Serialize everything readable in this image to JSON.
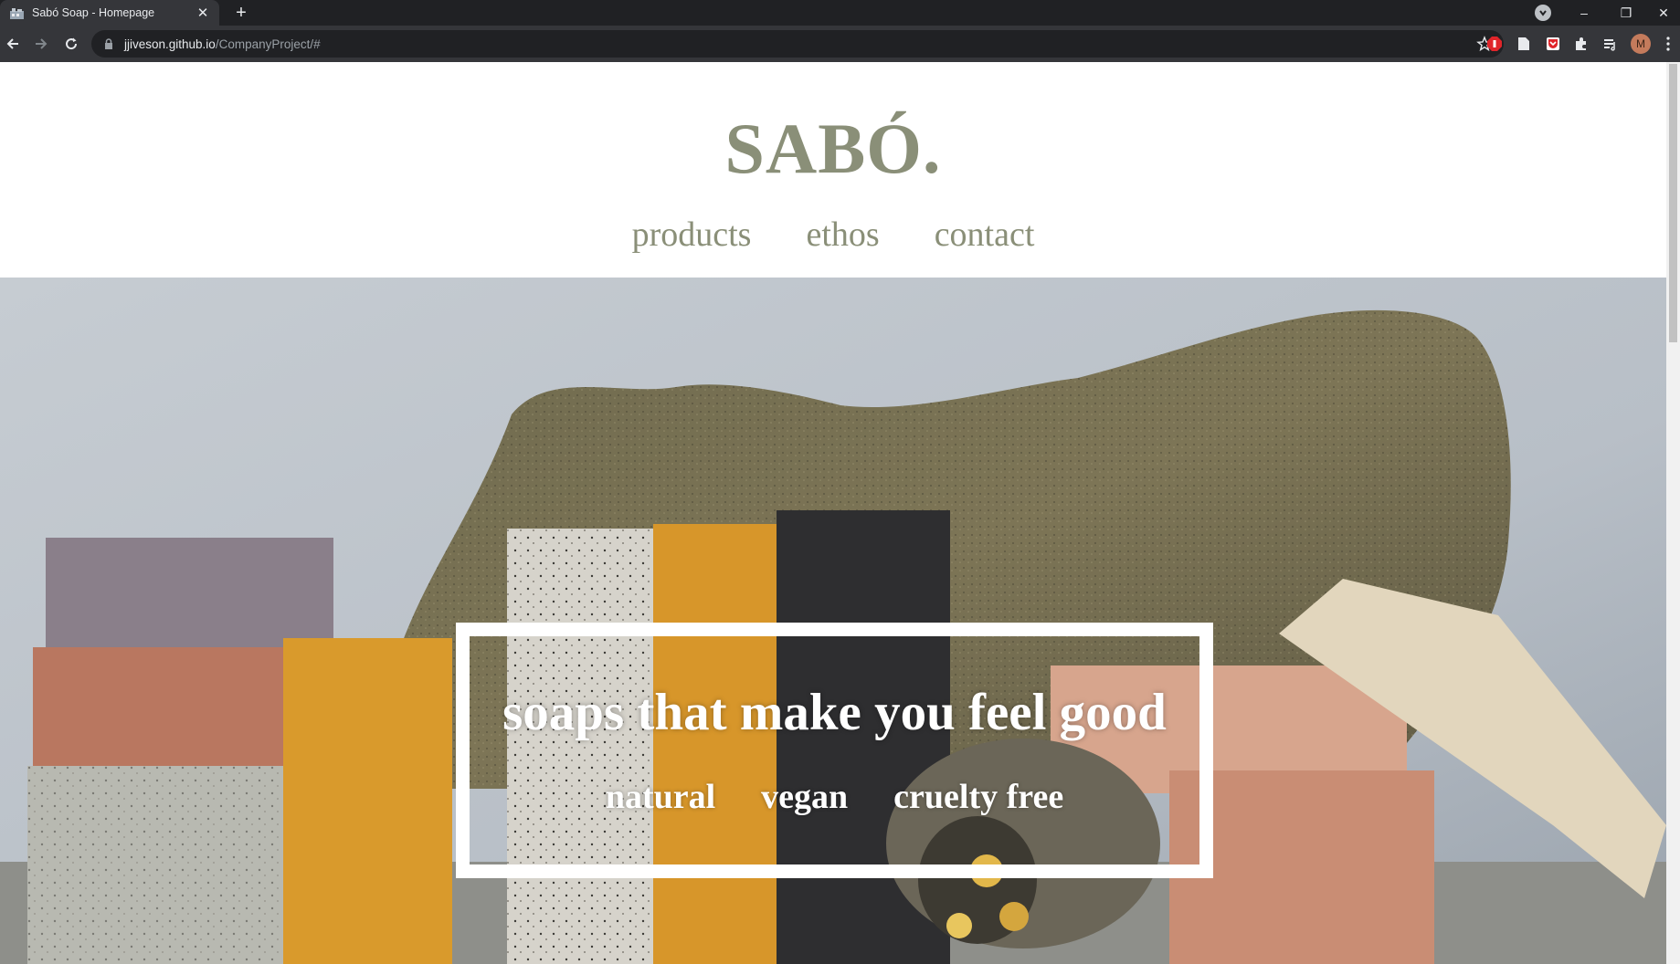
{
  "browser": {
    "tab_title": "Sabó Soap - Homepage",
    "tab_close": "✕",
    "new_tab": "+",
    "url_host": "jjiveson.github.io",
    "url_path": "/CompanyProject/#",
    "profile_initial": "M",
    "window_controls": {
      "minimize": "–",
      "restore": "❐",
      "close": "✕"
    }
  },
  "site": {
    "logo": "SABÓ.",
    "nav": [
      {
        "label": "products"
      },
      {
        "label": "ethos"
      },
      {
        "label": "contact"
      }
    ]
  },
  "hero": {
    "tagline": "soaps that make you feel good",
    "values": [
      "natural",
      "vegan",
      "cruelty free"
    ]
  },
  "colors": {
    "brand_text": "#8a8f78",
    "chrome_dark": "#202124",
    "chrome_mid": "#35363a"
  }
}
